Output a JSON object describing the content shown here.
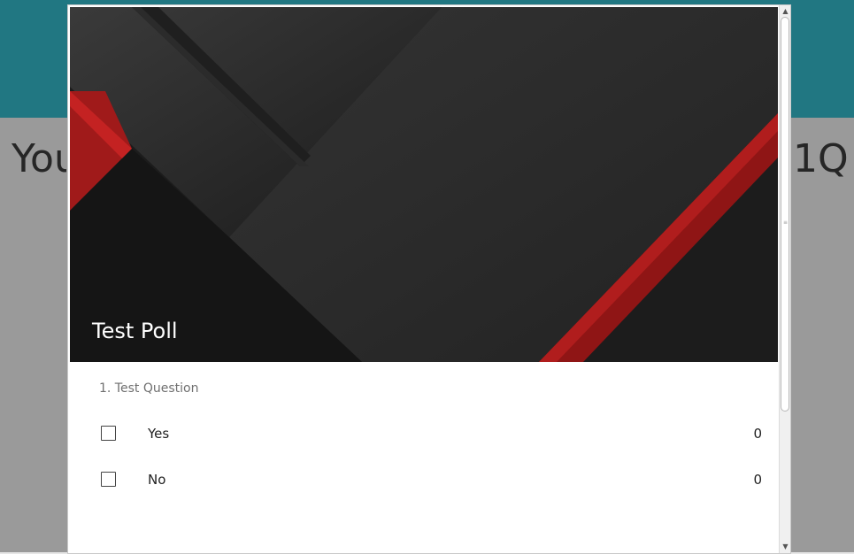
{
  "background": {
    "text_left": "You",
    "text_right": "1Q",
    "header_color": "#217782"
  },
  "poll": {
    "title": "Test Poll",
    "question": "1. Test Question",
    "options": [
      {
        "label": "Yes",
        "count": "0"
      },
      {
        "label": "No",
        "count": "0"
      }
    ]
  },
  "colors": {
    "hero_dark": "#1e1e1e",
    "hero_accent": "#b01a1a"
  }
}
